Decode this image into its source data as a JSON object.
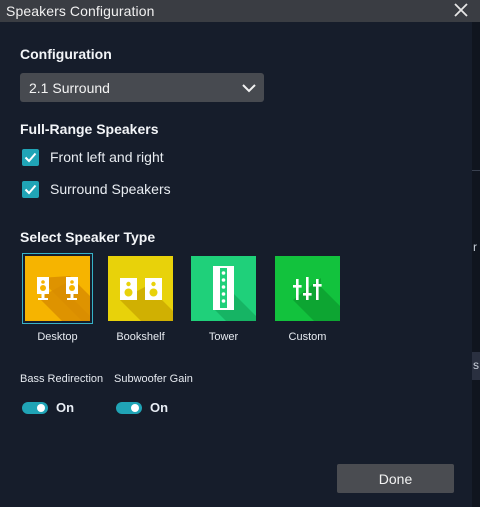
{
  "window": {
    "title": "Speakers Configuration"
  },
  "configuration": {
    "label": "Configuration",
    "selected": "2.1 Surround"
  },
  "full_range": {
    "label": "Full-Range Speakers",
    "items": [
      {
        "label": "Front left and right",
        "checked": true
      },
      {
        "label": "Surround Speakers",
        "checked": true
      }
    ]
  },
  "speaker_type": {
    "label": "Select Speaker Type",
    "selected": "Desktop",
    "tiles": [
      {
        "label": "Desktop",
        "color": "#f6b400",
        "icon": "desktop-speakers-icon"
      },
      {
        "label": "Bookshelf",
        "color": "#e8d20a",
        "icon": "bookshelf-speakers-icon"
      },
      {
        "label": "Tower",
        "color": "#1fd07a",
        "icon": "tower-speaker-icon"
      },
      {
        "label": "Custom",
        "color": "#12c23d",
        "icon": "equalizer-sliders-icon"
      }
    ]
  },
  "bass_redirection": {
    "label": "Bass Redirection",
    "state": "On"
  },
  "subwoofer_gain": {
    "label": "Subwoofer Gain",
    "state": "On"
  },
  "done_label": "Done",
  "colors": {
    "accent": "#20a4b6",
    "background": "#161d2b",
    "titlebar": "#3a3d43"
  }
}
